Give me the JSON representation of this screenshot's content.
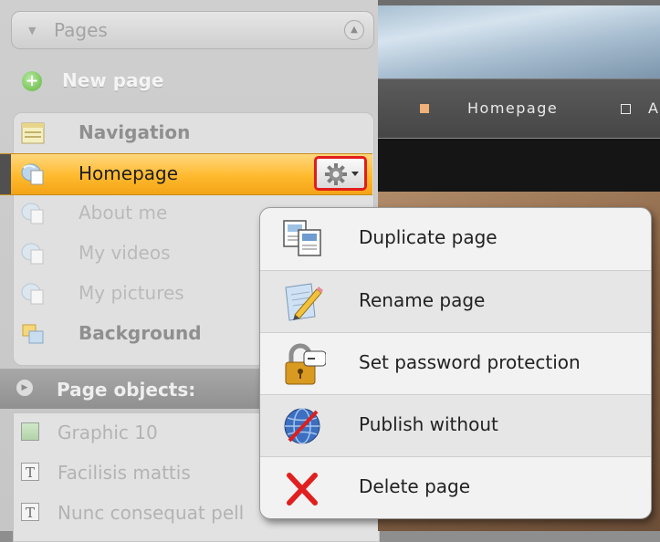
{
  "pages_panel": {
    "header": "Pages",
    "new_page": "New page",
    "items": [
      {
        "label": "Navigation",
        "icon": "navigation-icon"
      },
      {
        "label": "Homepage",
        "icon": "page-icon",
        "selected": true
      },
      {
        "label": "About me",
        "icon": "page-icon"
      },
      {
        "label": "My videos",
        "icon": "page-icon"
      },
      {
        "label": "My pictures",
        "icon": "page-icon"
      },
      {
        "label": "Background",
        "icon": "background-icon"
      }
    ]
  },
  "page_objects": {
    "header": "Page objects:",
    "items": [
      {
        "label": "Graphic 10",
        "icon": "image-icon"
      },
      {
        "label": "Facilisis mattis",
        "icon": "text-icon"
      },
      {
        "label": "Nunc consequat pell",
        "icon": "text-icon"
      }
    ]
  },
  "preview": {
    "nav": [
      "Homepage",
      "A"
    ]
  },
  "context_menu": {
    "items": [
      {
        "label": "Duplicate page",
        "icon": "duplicate-icon"
      },
      {
        "label": "Rename page",
        "icon": "rename-icon"
      },
      {
        "label": "Set password protection",
        "icon": "lock-icon"
      },
      {
        "label": "Publish without",
        "icon": "globe-no-publish-icon"
      },
      {
        "label": "Delete page",
        "icon": "delete-icon"
      }
    ]
  },
  "colors": {
    "selection": "#ffba2d",
    "highlight_border": "#e21d1d",
    "new_page_plus": "#5fb63c",
    "delete": "#e02020"
  }
}
